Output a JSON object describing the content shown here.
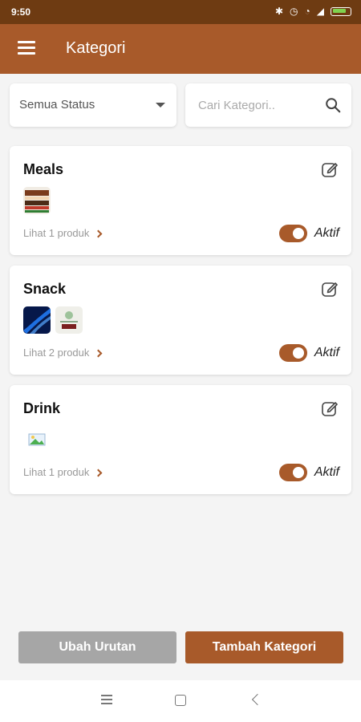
{
  "status_bar": {
    "time": "9:50",
    "icons": [
      "bluetooth-icon",
      "alarm-icon",
      "wifi-icon",
      "signal-icon",
      "battery-icon"
    ]
  },
  "app_bar": {
    "title": "Kategori",
    "menu_icon": "menu-icon"
  },
  "filters": {
    "status_select": {
      "value": "Semua Status"
    },
    "search": {
      "placeholder": "Cari Kategori..",
      "value": ""
    }
  },
  "categories": [
    {
      "name": "Meals",
      "product_link": "Lihat 1 produk",
      "status": "Aktif",
      "active": true,
      "thumbnails": [
        "food-photo"
      ]
    },
    {
      "name": "Snack",
      "product_link": "Lihat 2 produk",
      "status": "Aktif",
      "active": true,
      "thumbnails": [
        "blue-abstract-photo",
        "product-photo"
      ]
    },
    {
      "name": "Drink",
      "product_link": "Lihat 1 produk",
      "status": "Aktif",
      "active": true,
      "thumbnails": [
        "image-placeholder-icon"
      ]
    }
  ],
  "buttons": {
    "reorder": "Ubah Urutan",
    "add": "Tambah Kategori"
  },
  "colors": {
    "primary": "#a85a2a",
    "status_bar": "#6e3b12",
    "background": "#f4f4f4",
    "disabled_button": "#a6a6a6"
  }
}
